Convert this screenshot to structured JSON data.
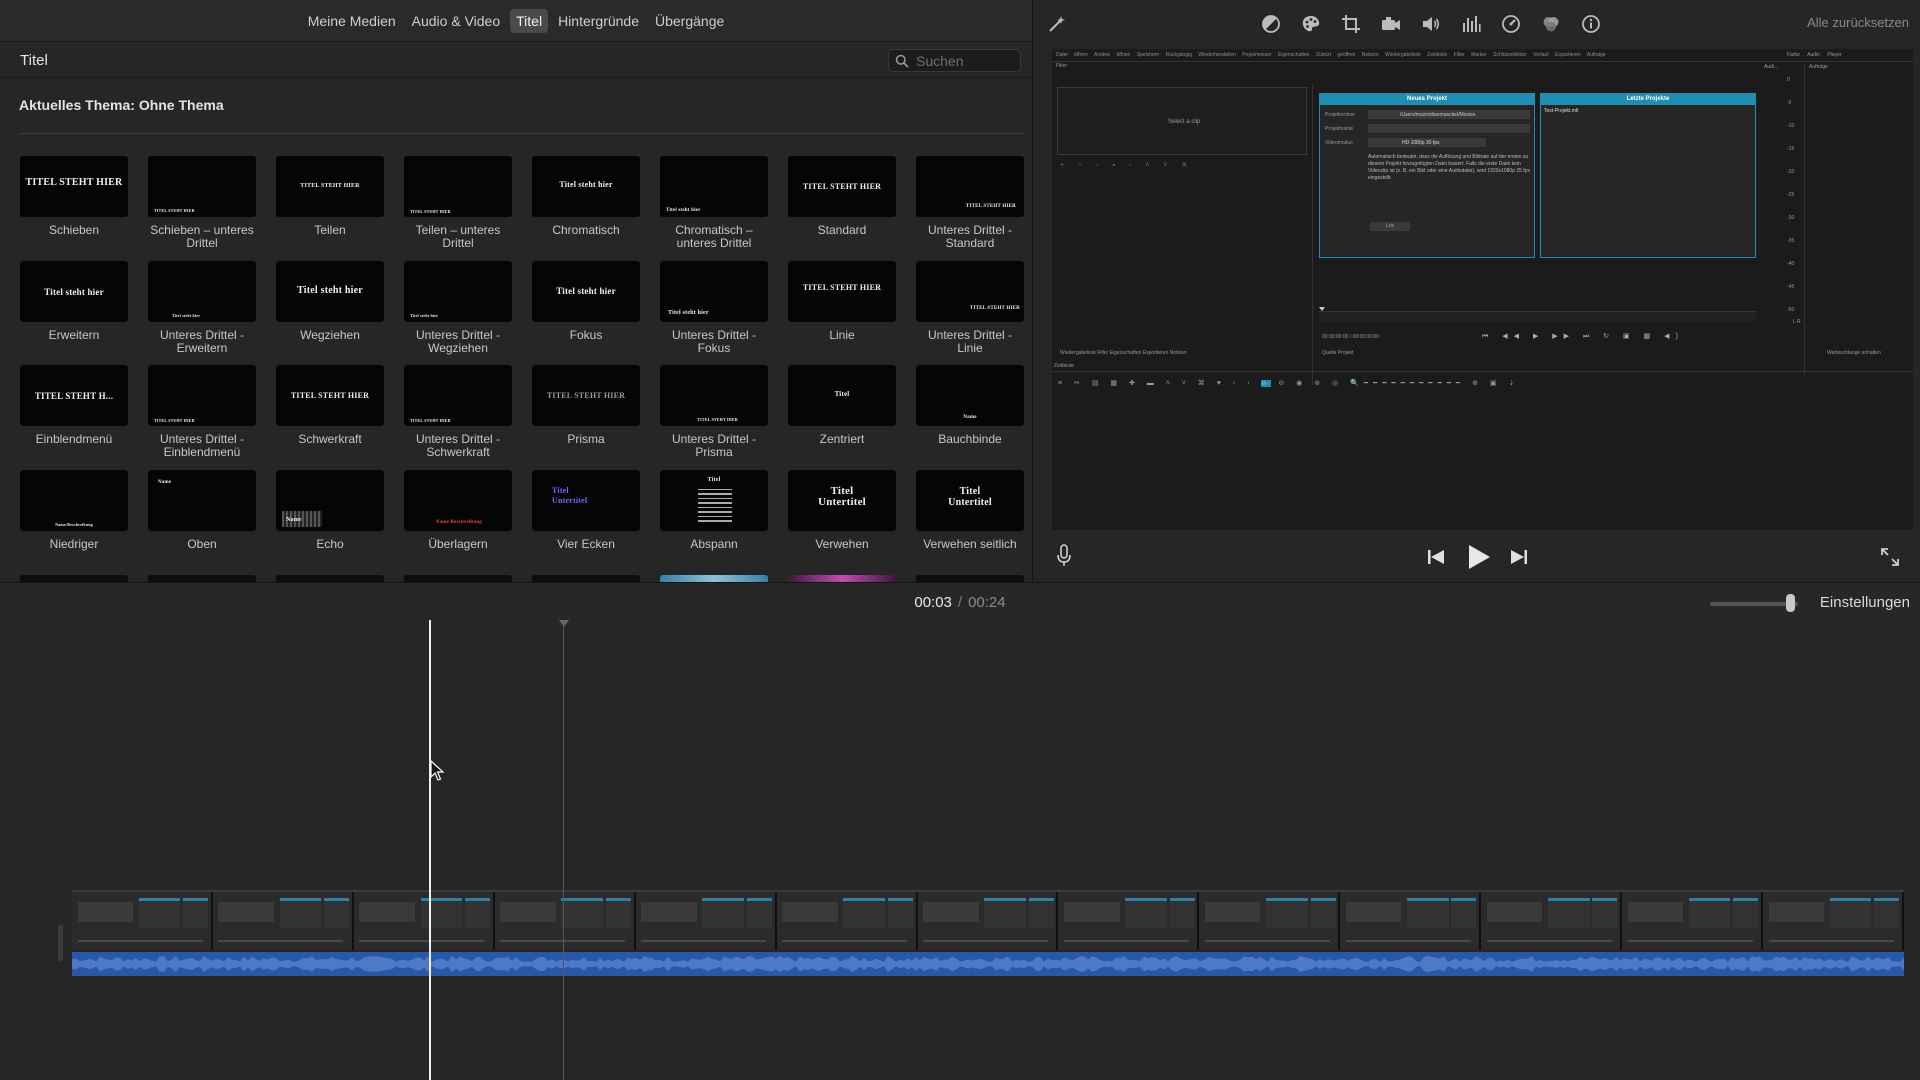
{
  "browser": {
    "tabs": [
      {
        "label": "Meine Medien"
      },
      {
        "label": "Audio & Video"
      },
      {
        "label": "Titel"
      },
      {
        "label": "Hintergründe"
      },
      {
        "label": "Übergänge"
      }
    ],
    "title": "Titel",
    "search_placeholder": "Suchen",
    "theme_label": "Aktuelles Thema: Ohne Thema",
    "titles": [
      {
        "label": "Schieben",
        "thumb": "TITEL STEHT HIER"
      },
      {
        "label": "Schieben – unteres Drittel",
        "thumb": "TITEL STEHT HIER"
      },
      {
        "label": "Teilen",
        "thumb": "TITEL STEHT HIER"
      },
      {
        "label": "Teilen – unteres Drittel",
        "thumb": "TITEL STEHT HIER"
      },
      {
        "label": "Chromatisch",
        "thumb": "Titel steht hier"
      },
      {
        "label": "Chromatisch – unteres Drittel",
        "thumb": "Titel steht hier"
      },
      {
        "label": "Standard",
        "thumb": "TITEL STEHT HIER"
      },
      {
        "label": "Unteres Drittel - Standard",
        "thumb": "TITEL STEHT HIER"
      },
      {
        "label": "Erweitern",
        "thumb": "Titel steht hier"
      },
      {
        "label": "Unteres Drittel - Erweitern",
        "thumb": "Titel steht hier"
      },
      {
        "label": "Wegziehen",
        "thumb": "Titel steht hier"
      },
      {
        "label": "Unteres Drittel - Wegziehen",
        "thumb": "Titel steht hier"
      },
      {
        "label": "Fokus",
        "thumb": "Titel steht hier"
      },
      {
        "label": "Unteres Drittel - Fokus",
        "thumb": "Titel steht hier"
      },
      {
        "label": "Linie",
        "thumb": "TITEL STEHT HIER"
      },
      {
        "label": "Unteres Drittel - Linie",
        "thumb": "TITEL STEHT HIER"
      },
      {
        "label": "Einblendmenü",
        "thumb": "TITEL STEHT H..."
      },
      {
        "label": "Unteres Drittel - Einblendmenü",
        "thumb": "TITEL STEHT HIER"
      },
      {
        "label": "Schwerkraft",
        "thumb": "TITEL STEHT HIER"
      },
      {
        "label": "Unteres Drittel - Schwerkraft",
        "thumb": "TITEL STEHT HIER"
      },
      {
        "label": "Prisma",
        "thumb": "TITEL STEHT HIER"
      },
      {
        "label": "Unteres Drittel - Prisma",
        "thumb": "TITEL STEHT HIER"
      },
      {
        "label": "Zentriert",
        "thumb": "Titel"
      },
      {
        "label": "Bauchbinde",
        "thumb": "Name"
      },
      {
        "label": "Niedriger",
        "thumb": "Name/Beschreibung"
      },
      {
        "label": "Oben",
        "thumb": "Name"
      },
      {
        "label": "Echo",
        "thumb": "Name"
      },
      {
        "label": "Überlagern",
        "thumb": "Name Beschreibung"
      },
      {
        "label": "Vier Ecken",
        "thumb": "Titel Untertitel"
      },
      {
        "label": "Abspann",
        "thumb": "Titel"
      },
      {
        "label": "Verwehen",
        "thumb": "Titel Untertitel"
      },
      {
        "label": "Verwehen seitlich",
        "thumb": "Titel Untertitel"
      }
    ]
  },
  "viewer": {
    "reset_label": "Alle zurücksetzen",
    "toolbar_icons": [
      "magic-wand-icon",
      "color-balance-icon",
      "color-palette-icon",
      "crop-icon",
      "camera-icon",
      "volume-icon",
      "equalizer-icon",
      "speed-icon",
      "filter-icon",
      "info-icon"
    ],
    "preview": {
      "menu": "Datei öffnen  Andere öffnen  Speichern  Rückgängig  Wiederherstellen  Pegelmesser  Eigenschaften  Zuletzt geöffnet  Notizen  Wiedergabeliste  Zeitleiste  Filter  Marker  Schlüsselbilder  Verlauf  Exportieren  Aufträge",
      "right_menu": "Farbe   Audio   Player",
      "filter_label": "Filter",
      "select_clip": "Select a clip",
      "new_project": "Neues Projekt",
      "recent_projects": "Letzte Projekte",
      "project_folder_label": "Projektordner",
      "project_folder_value": "/Users/maximilianmueckel/Movies",
      "project_name_label": "Projektname",
      "video_mode_label": "Videomodus",
      "video_mode_value": "HD 1080p 30 fps",
      "description": "Automatisch bedeutet, dass die Auflösung und Bildrate auf der ersten zu diesem Projekt hinzugefügten Datei basiert. Falls die erste Datei kein Videoclip ist (z. B. ein Bild oder eine Audiodatei), wird 1920x1080p 25 fps eingestellt.",
      "start_button": "Los",
      "recent_item": "Test-Projekt.mlt",
      "timecode": "00:00:00:00  / 00:00:00:00",
      "tabs_left": "Wiedergabeliste   Filter   Eigenschaften   Exportieren   Notizen",
      "tabs_mid": "Quelle   Projekt",
      "queue_label": "Warteschlange anhalten",
      "timeline_label": "Zeitleiste",
      "audio_label": "Audi...",
      "jobs_label": "Aufträge",
      "meter_ticks": [
        "0",
        "-5",
        "-10",
        "-15",
        "-20",
        "-25",
        "-30",
        "-35",
        "-40",
        "-45",
        "-50"
      ],
      "lr_label": "L  R"
    }
  },
  "timeline": {
    "current_time": "00:03",
    "separator": "/",
    "total_time": "00:24",
    "settings_label": "Einstellungen",
    "frame_count": 13
  },
  "colors": {
    "accent_blue": "#2b57a8",
    "preview_header_blue": "#1e8fb3"
  }
}
